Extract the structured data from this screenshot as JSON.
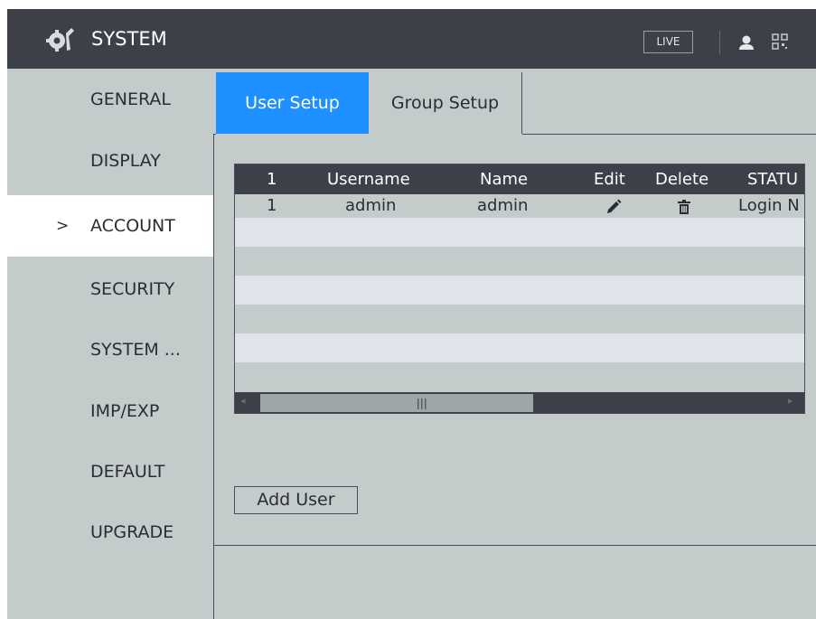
{
  "header": {
    "title": "SYSTEM",
    "live_label": "LIVE",
    "icons": [
      "system-settings-icon",
      "user-icon",
      "qr-code-icon"
    ]
  },
  "sidebar": {
    "active_marker": ">",
    "items": [
      {
        "label": "GENERAL"
      },
      {
        "label": "DISPLAY"
      },
      {
        "label": "ACCOUNT",
        "active": true
      },
      {
        "label": "SECURITY"
      },
      {
        "label": "SYSTEM ..."
      },
      {
        "label": "IMP/EXP"
      },
      {
        "label": "DEFAULT"
      },
      {
        "label": "UPGRADE"
      }
    ]
  },
  "tabs": [
    {
      "label": "User Setup",
      "active": true
    },
    {
      "label": "Group Setup",
      "active": false
    }
  ],
  "user_table": {
    "columns": [
      "1",
      "Username",
      "Name",
      "Edit",
      "Delete",
      "STATU"
    ],
    "rows": [
      {
        "index": "1",
        "username": "admin",
        "name": "admin",
        "status": "Login N"
      }
    ]
  },
  "add_user_label": "Add User",
  "colors": {
    "header_bg": "#3d4049",
    "panel_bg": "#c3cbcb",
    "active_tab": "#1e90ff",
    "row_light": "#dfe3ea"
  }
}
